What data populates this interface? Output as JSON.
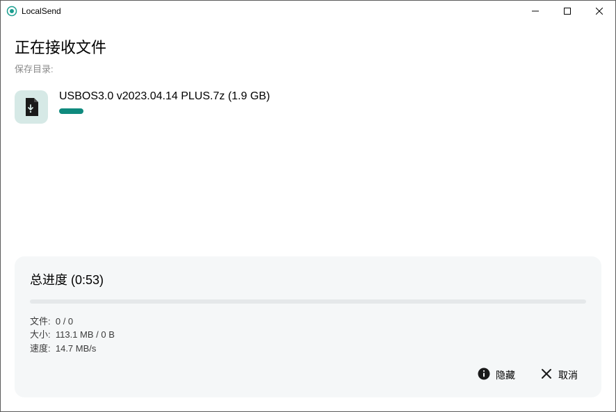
{
  "window": {
    "title": "LocalSend"
  },
  "header": {
    "title": "正在接收文件",
    "save_dir_label": "保存目录:"
  },
  "file": {
    "name": "USBOS3.0 v2023.04.14 PLUS.7z (1.9 GB)"
  },
  "total": {
    "title": "总进度 (0:53)",
    "files_label": "文件:",
    "files_value": "0 / 0",
    "size_label": "大小:",
    "size_value": "113.1 MB / 0 B",
    "speed_label": "速度:",
    "speed_value": "14.7 MB/s"
  },
  "actions": {
    "hide_label": "隐藏",
    "cancel_label": "取消"
  }
}
